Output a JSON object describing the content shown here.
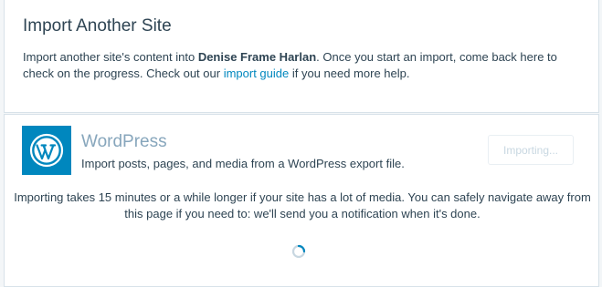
{
  "header": {
    "title": "Import Another Site",
    "intro_prefix": "Import another site's content into ",
    "site_name": "Denise Frame Harlan",
    "intro_middle": ". Once you start an import, come back here to check on the progress. Check out our ",
    "guide_link": "import guide",
    "intro_suffix": " if you need more help."
  },
  "importer": {
    "logo_icon": "wordpress-logo-icon",
    "name": "WordPress",
    "description": "Import posts, pages, and media from a WordPress export file.",
    "button_label": "Importing...",
    "progress_message": "Importing takes 15 minutes or a while longer if your site has a lot of media. You can safely navigate away from this page if you need to: we'll send you a notification when it's done.",
    "spinner_icon": "loading-spinner-icon"
  },
  "colors": {
    "accent": "#0087be",
    "title_muted": "#87a6bc",
    "text": "#2e4453",
    "border": "#d8e2e9"
  }
}
